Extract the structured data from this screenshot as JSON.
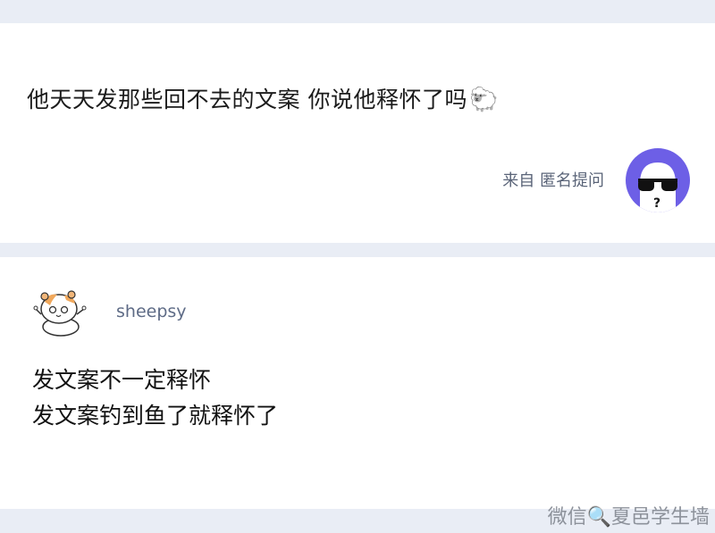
{
  "question": {
    "text": "他天天发那些回不去的文案 你说他释怀了吗",
    "emoji": "🐑",
    "from_label": "来自 匿名提问",
    "avatar_icon": "anonymous-sunglasses-icon"
  },
  "answer": {
    "author_name": "sheepsy",
    "avatar_icon": "hamster-avatar-icon",
    "lines": [
      "发文案不一定释怀",
      "发文案钓到鱼了就释怀了"
    ]
  },
  "watermark": "微信🔍夏邑学生墙",
  "colors": {
    "page_bg": "#e9edf5",
    "card_bg": "#ffffff",
    "anon_avatar_bg": "#6d5fe6",
    "name_color": "#5e6b86"
  }
}
